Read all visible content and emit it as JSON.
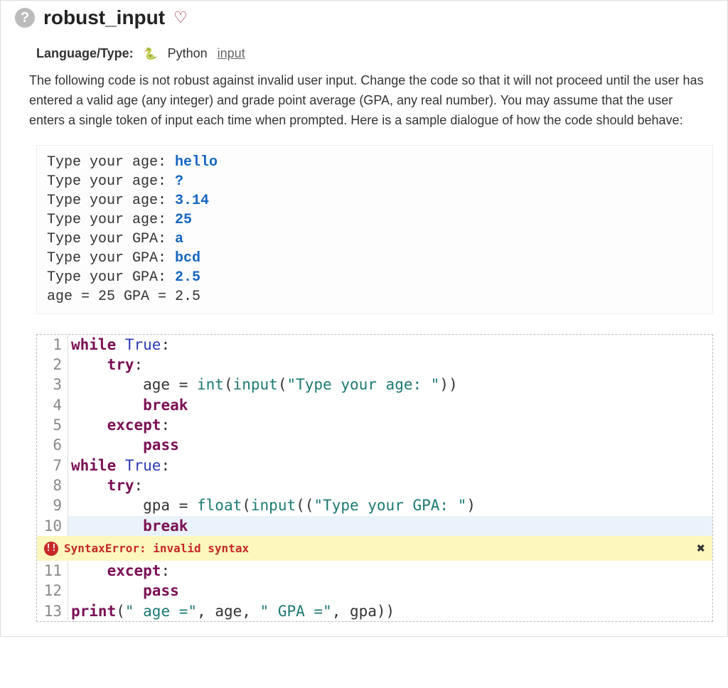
{
  "header": {
    "title": "robust_input",
    "qmark": "?",
    "heart": "♡"
  },
  "meta": {
    "label": "Language/Type:",
    "py_icon": "🐍",
    "language": "Python",
    "link": "input"
  },
  "problem": "The following code is not robust against invalid user input. Change the code so that it will not proceed until the user has entered a valid age (any integer) and grade point average (GPA, any real number). You may assume that the user enters a single token of input each time when prompted. Here is a sample dialogue of how the code should behave:",
  "sample": [
    {
      "prompt": "Type your age: ",
      "input": "hello"
    },
    {
      "prompt": "Type your age: ",
      "input": "?"
    },
    {
      "prompt": "Type your age: ",
      "input": "3.14"
    },
    {
      "prompt": "Type your age: ",
      "input": "25"
    },
    {
      "prompt": "Type your GPA: ",
      "input": "a"
    },
    {
      "prompt": "Type your GPA: ",
      "input": "bcd"
    },
    {
      "prompt": "Type your GPA: ",
      "input": "2.5"
    }
  ],
  "sample_result": "age = 25  GPA = 2.5",
  "code": {
    "lines": [
      {
        "n": "1",
        "segs": [
          {
            "t": "while ",
            "c": "kw"
          },
          {
            "t": "True",
            "c": "bool"
          },
          {
            "t": ":",
            "c": ""
          }
        ]
      },
      {
        "n": "2",
        "segs": [
          {
            "t": "    ",
            "c": ""
          },
          {
            "t": "try",
            "c": "kw"
          },
          {
            "t": ":",
            "c": ""
          }
        ]
      },
      {
        "n": "3",
        "segs": [
          {
            "t": "        age = ",
            "c": ""
          },
          {
            "t": "int",
            "c": "fn"
          },
          {
            "t": "(",
            "c": ""
          },
          {
            "t": "input",
            "c": "fn"
          },
          {
            "t": "(",
            "c": ""
          },
          {
            "t": "\"Type your age: \"",
            "c": "str"
          },
          {
            "t": "))",
            "c": ""
          }
        ]
      },
      {
        "n": "4",
        "segs": [
          {
            "t": "        ",
            "c": ""
          },
          {
            "t": "break",
            "c": "kw"
          }
        ]
      },
      {
        "n": "5",
        "segs": [
          {
            "t": "    ",
            "c": ""
          },
          {
            "t": "except",
            "c": "kw"
          },
          {
            "t": ":",
            "c": ""
          }
        ]
      },
      {
        "n": "6",
        "segs": [
          {
            "t": "        ",
            "c": ""
          },
          {
            "t": "pass",
            "c": "kw"
          }
        ]
      },
      {
        "n": "7",
        "segs": [
          {
            "t": "while ",
            "c": "kw"
          },
          {
            "t": "True",
            "c": "bool"
          },
          {
            "t": ":",
            "c": ""
          }
        ]
      },
      {
        "n": "8",
        "segs": [
          {
            "t": "    ",
            "c": ""
          },
          {
            "t": "try",
            "c": "kw"
          },
          {
            "t": ":",
            "c": ""
          }
        ]
      },
      {
        "n": "9",
        "segs": [
          {
            "t": "        gpa = ",
            "c": ""
          },
          {
            "t": "float",
            "c": "fn"
          },
          {
            "t": "(",
            "c": ""
          },
          {
            "t": "input",
            "c": "fn"
          },
          {
            "t": "((",
            "c": ""
          },
          {
            "t": "\"Type your GPA: \"",
            "c": "str"
          },
          {
            "t": ")",
            "c": ""
          }
        ]
      },
      {
        "n": "10",
        "segs": [
          {
            "t": "        ",
            "c": ""
          },
          {
            "t": "break",
            "c": "kw"
          }
        ],
        "hl": true
      },
      {
        "n": "11",
        "segs": [
          {
            "t": "    ",
            "c": ""
          },
          {
            "t": "except",
            "c": "kw"
          },
          {
            "t": ":",
            "c": ""
          }
        ]
      },
      {
        "n": "12",
        "segs": [
          {
            "t": "        ",
            "c": ""
          },
          {
            "t": "pass",
            "c": "kw"
          }
        ]
      },
      {
        "n": "13",
        "segs": [
          {
            "t": "print",
            "c": "kw"
          },
          {
            "t": "(",
            "c": ""
          },
          {
            "t": "\" age =\"",
            "c": "str"
          },
          {
            "t": ", age, ",
            "c": ""
          },
          {
            "t": "\" GPA =\"",
            "c": "str"
          },
          {
            "t": ", gpa))",
            "c": ""
          }
        ]
      }
    ],
    "error": {
      "after_line": "10",
      "icon": "!!",
      "text": "SyntaxError: invalid syntax",
      "close": "✖"
    }
  }
}
